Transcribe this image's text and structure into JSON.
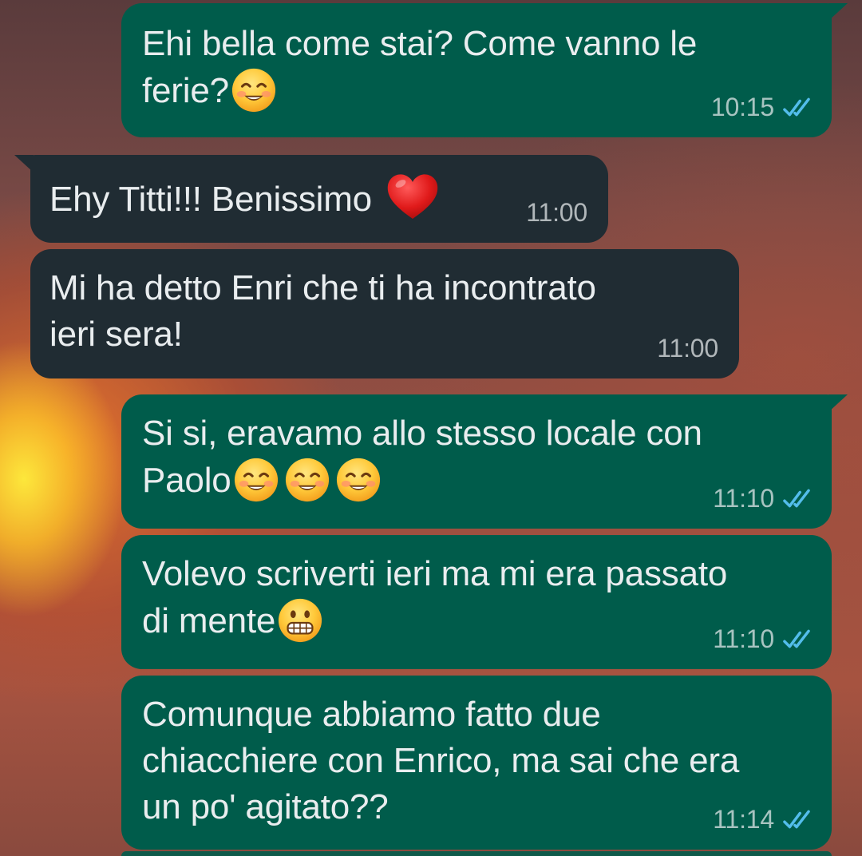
{
  "messages": [
    {
      "lines": [
        "Ehi bella come stai? Come vanno le",
        "ferie?"
      ],
      "time": "10:15",
      "direction": "outgoing",
      "status": "read",
      "emojis": [
        "smiling-face"
      ]
    },
    {
      "lines": [
        "Ehy Titti!!! Benissimo"
      ],
      "time": "11:00",
      "direction": "incoming",
      "emojis": [
        "red-heart"
      ]
    },
    {
      "lines": [
        "Mi ha detto Enri che ti ha incontrato",
        "ieri sera!"
      ],
      "time": "11:00",
      "direction": "incoming"
    },
    {
      "lines": [
        "Si si, eravamo allo stesso locale con",
        "Paolo"
      ],
      "time": "11:10",
      "direction": "outgoing",
      "status": "read",
      "emojis": [
        "smiling-face",
        "smiling-face",
        "smiling-face"
      ]
    },
    {
      "lines": [
        "Volevo scriverti ieri ma mi era passato",
        "di mente"
      ],
      "time": "11:10",
      "direction": "outgoing",
      "status": "read",
      "emojis": [
        "grimacing-face"
      ]
    },
    {
      "lines": [
        "Comunque abbiamo fatto due",
        "chiacchiere con Enrico, ma sai che era",
        "un po' agitato??"
      ],
      "time": "11:14",
      "direction": "outgoing",
      "status": "read"
    }
  ],
  "colors": {
    "outgoing_bubble": "#005c4b",
    "incoming_bubble": "#202c33",
    "read_ticks": "#53bdeb",
    "text": "#e9edef"
  }
}
